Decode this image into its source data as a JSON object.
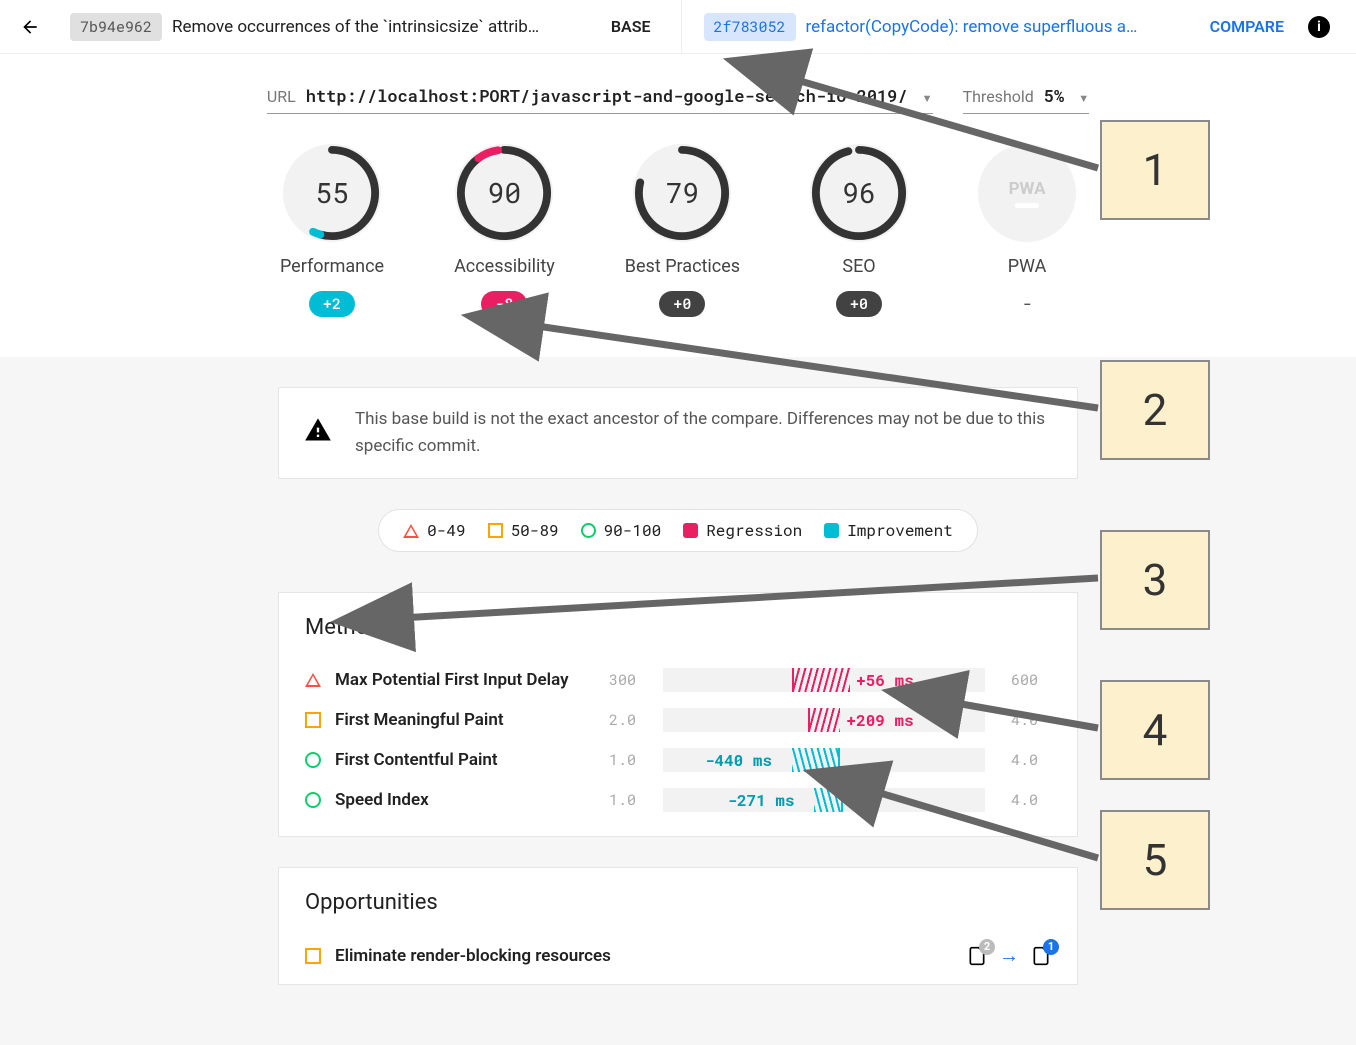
{
  "header": {
    "base_hash": "7b94e962",
    "base_msg": "Remove occurrences of the `intrinsicsize` attrib…",
    "base_tag": "BASE",
    "compare_hash": "2f783052",
    "compare_msg": "refactor(CopyCode): remove superfluous a…",
    "compare_tag": "COMPARE"
  },
  "subheader": {
    "url_label": "URL",
    "url_value": "http://localhost:PORT/javascript-and-google-search-io-2019/",
    "threshold_label": "Threshold",
    "threshold_value": "5%"
  },
  "gauges": {
    "perf": {
      "score": "55",
      "label": "Performance",
      "delta": "+2",
      "delta_cls": "teal"
    },
    "a11y": {
      "score": "90",
      "label": "Accessibility",
      "delta": "-8",
      "delta_cls": "pink"
    },
    "bp": {
      "score": "79",
      "label": "Best Practices",
      "delta": "+0",
      "delta_cls": "dark"
    },
    "seo": {
      "score": "96",
      "label": "SEO",
      "delta": "+0",
      "delta_cls": "dark"
    },
    "pwa": {
      "label": "PWA",
      "delta": "-"
    }
  },
  "warning": "This base build is not the exact ancestor of the compare. Differences may not be due to this specific commit.",
  "legend": {
    "r1": "0-49",
    "r2": "50-89",
    "r3": "90-100",
    "reg": "Regression",
    "imp": "Improvement"
  },
  "metrics": {
    "title": "Metrics",
    "rows": [
      {
        "shape": "tri",
        "name": "Max Potential First Input Delay",
        "min": "300",
        "max": "600",
        "delta": "+56 ms",
        "dcls": "pink",
        "hstart": 40,
        "hend": 58,
        "lblpos": 60
      },
      {
        "shape": "sq",
        "name": "First Meaningful Paint",
        "min": "2.0",
        "max": "4.0",
        "delta": "+209 ms",
        "dcls": "pink",
        "hstart": 45,
        "hend": 55,
        "lblpos": 57
      },
      {
        "shape": "circ",
        "name": "First Contentful Paint",
        "min": "1.0",
        "max": "4.0",
        "delta": "-440 ms",
        "dcls": "teal",
        "hstart": 40,
        "hend": 55,
        "lblpos": 13
      },
      {
        "shape": "circ",
        "name": "Speed Index",
        "min": "1.0",
        "max": "4.0",
        "delta": "-271 ms",
        "dcls": "teal",
        "hstart": 47,
        "hend": 56,
        "lblpos": 20
      }
    ]
  },
  "opportunities": {
    "title": "Opportunities",
    "rows": [
      {
        "shape": "sq",
        "name": "Eliminate render-blocking resources",
        "badge1": "2",
        "badge2": "1"
      }
    ]
  },
  "annotations": {
    "a1": "1",
    "a2": "2",
    "a3": "3",
    "a4": "4",
    "a5": "5"
  }
}
